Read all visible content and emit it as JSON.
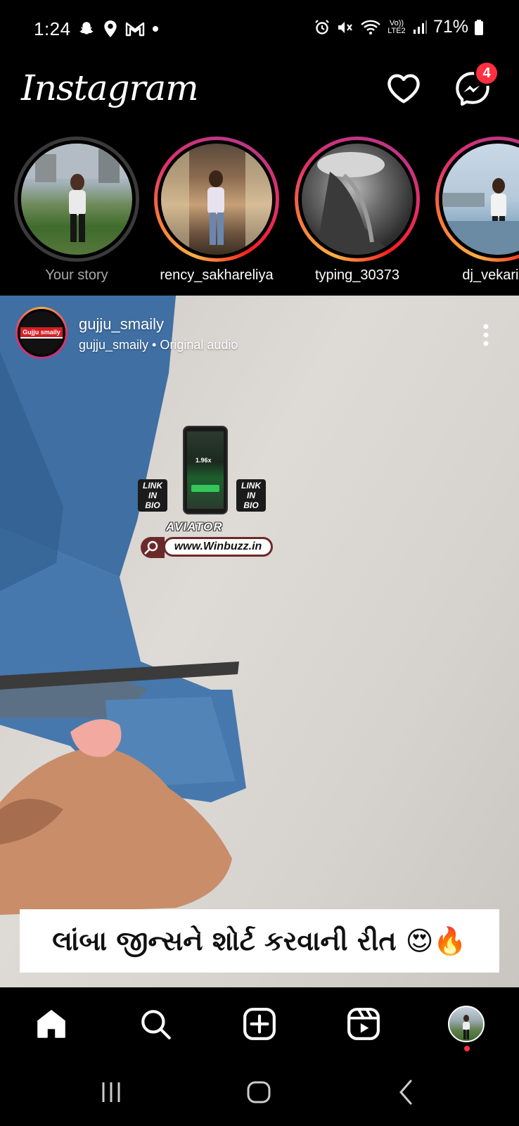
{
  "status_bar": {
    "time": "1:24",
    "network": "Vo)) LTE2",
    "battery": "71%",
    "left_icons": [
      "snapchat-icon",
      "location-icon",
      "gmail-icon",
      "dot-icon"
    ],
    "right_icons": [
      "alarm-icon",
      "mute-icon",
      "wifi-icon",
      "signal-icon",
      "battery-icon"
    ]
  },
  "header": {
    "logo": "Instagram",
    "notifications_icon": "heart-icon",
    "messenger_icon": "messenger-icon",
    "messenger_badge": "4"
  },
  "stories": [
    {
      "label": "Your story",
      "seen": true
    },
    {
      "label": "rency_sakhareliya",
      "seen": false
    },
    {
      "label": "typing_30373",
      "seen": false
    },
    {
      "label": "dj_vekariya",
      "seen": false
    }
  ],
  "post": {
    "username": "gujju_smaily",
    "audio": "gujju_smaily • Original audio",
    "avatar_text": "Gujju smaily",
    "overlay": {
      "multiplier": "1.96x",
      "link_in_bio": "LINK\nIN\nBIO",
      "aviator": "AVIATOR",
      "website": "www.Winbuzz.in"
    },
    "caption": "લાંબા જીન્સને શોર્ટ કરવાની રીત 😍🔥"
  },
  "bottom_nav": {
    "items": [
      "home-icon",
      "search-icon",
      "create-icon",
      "reels-icon",
      "profile-avatar"
    ]
  },
  "colors": {
    "badge": "#ff3040",
    "background": "#000000",
    "text": "#ffffff"
  }
}
